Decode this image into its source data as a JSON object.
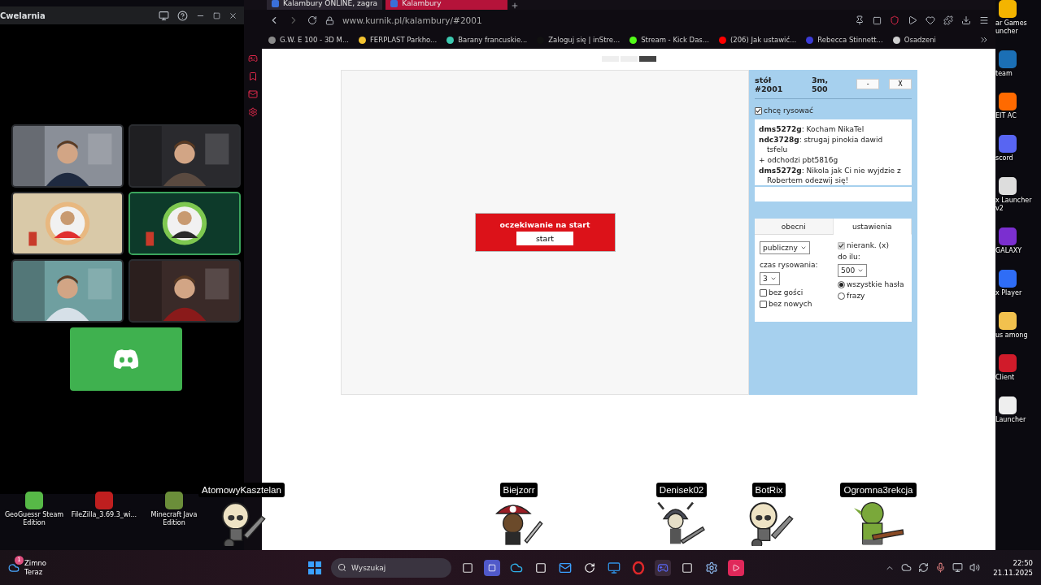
{
  "discord_window": {
    "title": "Cwelarnia",
    "tiles": [
      {
        "kind": "camera",
        "speaking": false
      },
      {
        "kind": "camera",
        "speaking": false
      },
      {
        "kind": "avatar",
        "speaking": false
      },
      {
        "kind": "avatar",
        "speaking": true
      },
      {
        "kind": "camera",
        "speaking": false
      },
      {
        "kind": "camera",
        "speaking": false
      }
    ]
  },
  "browser": {
    "tabs": [
      {
        "label": "Kalambury ONLINE, zagra",
        "selected": false
      },
      {
        "label": "Kalambury",
        "selected": true
      }
    ],
    "address": "www.kurnik.pl/kalambury/#2001",
    "bookmarks": [
      {
        "label": "G.W. E 100 - 3D M...",
        "color": "#8a8a8a"
      },
      {
        "label": "FERPLAST Parkho...",
        "color": "#f2c230"
      },
      {
        "label": "Barany francuskie...",
        "color": "#3cc9b0"
      },
      {
        "label": "Zaloguj się | inStre...",
        "color": "#111111"
      },
      {
        "label": "Stream - Kick Das...",
        "color": "#53fc18"
      },
      {
        "label": "(206) Jak ustawić...",
        "color": "#ff0000"
      },
      {
        "label": "Rebecca Stinnett...",
        "color": "#3b3bd6"
      },
      {
        "label": "Osadzeni",
        "color": "#cfcfcf"
      }
    ]
  },
  "game": {
    "status": "oczekiwanie na start",
    "start_button": "start",
    "table": "stół #2001",
    "info": "3m, 500",
    "header_buttons": [
      "-",
      "X"
    ],
    "want_to_draw": {
      "label": "chcę rysować",
      "checked": true
    },
    "chat": [
      {
        "kind": "message",
        "text": "**dms5272g**: Kocham NikaTel"
      },
      {
        "kind": "message",
        "text": "**ndc3728g**: strugaj pinokia dawid tsfelu"
      },
      {
        "kind": "system",
        "text": "+ odchodzi pbt5816g"
      },
      {
        "kind": "message",
        "text": "**dms5272g**: Nikola jak Ci nie wyjdzie z Robertem odezwij się!"
      }
    ],
    "tabs": [
      {
        "label": "obecni",
        "selected": false
      },
      {
        "label": "ustawienia",
        "selected": true
      }
    ],
    "settings": {
      "visibility": "publiczny",
      "unranked": {
        "label": "nierank. (x)",
        "checked": true,
        "disabled": true
      },
      "draw_time_label": "czas rysowania:",
      "draw_time": "3",
      "target_label": "do ilu:",
      "target": "500",
      "options": [
        {
          "label": "bez gości",
          "checked": false
        },
        {
          "label": "bez nowych",
          "checked": false
        }
      ],
      "word_sets": [
        {
          "label": "wszystkie hasła",
          "selected": true
        },
        {
          "label": "frazy",
          "selected": false
        }
      ]
    }
  },
  "players": [
    {
      "name": "AtomowyKasztelan",
      "kind": "skeleton"
    },
    {
      "name": "Biejzorr",
      "kind": "pirate"
    },
    {
      "name": "Denisek02",
      "kind": "knight"
    },
    {
      "name": "BotRix",
      "kind": "skeleton"
    },
    {
      "name": "Ogromna3rekcja",
      "kind": "orc"
    }
  ],
  "desktop_icons_right": [
    {
      "label": "ar Games uncher",
      "color": "#f4b400"
    },
    {
      "label": "team",
      "color": "#1b6fb5"
    },
    {
      "label": "EIT AC",
      "color": "#ff6a00"
    },
    {
      "label": "scord",
      "color": "#5865f2"
    },
    {
      "label": "x Launcher v2",
      "color": "#dddddd"
    },
    {
      "label": "GALAXY",
      "color": "#7b2fd0"
    },
    {
      "label": "x Player",
      "color": "#2f6df6"
    },
    {
      "label": "us among",
      "color": "#f2c14e"
    },
    {
      "label": "Client",
      "color": "#d01b2a"
    },
    {
      "label": "Launcher",
      "color": "#eeeeee"
    }
  ],
  "desktop_icons_bottom": [
    {
      "label": "GeoGuessr Steam Edition",
      "color": "#57b947"
    },
    {
      "label": "FileZilla_3.69.3_wi...",
      "color": "#bf1f1f"
    },
    {
      "label": "Minecraft Java Edition",
      "color": "#6b8e3a"
    }
  ],
  "taskbar": {
    "weather": "Zimno",
    "weather_time": "Teraz",
    "badge": "1",
    "search_placeholder": "Wyszukaj",
    "time": "22:50",
    "date": "21.11.2025"
  }
}
